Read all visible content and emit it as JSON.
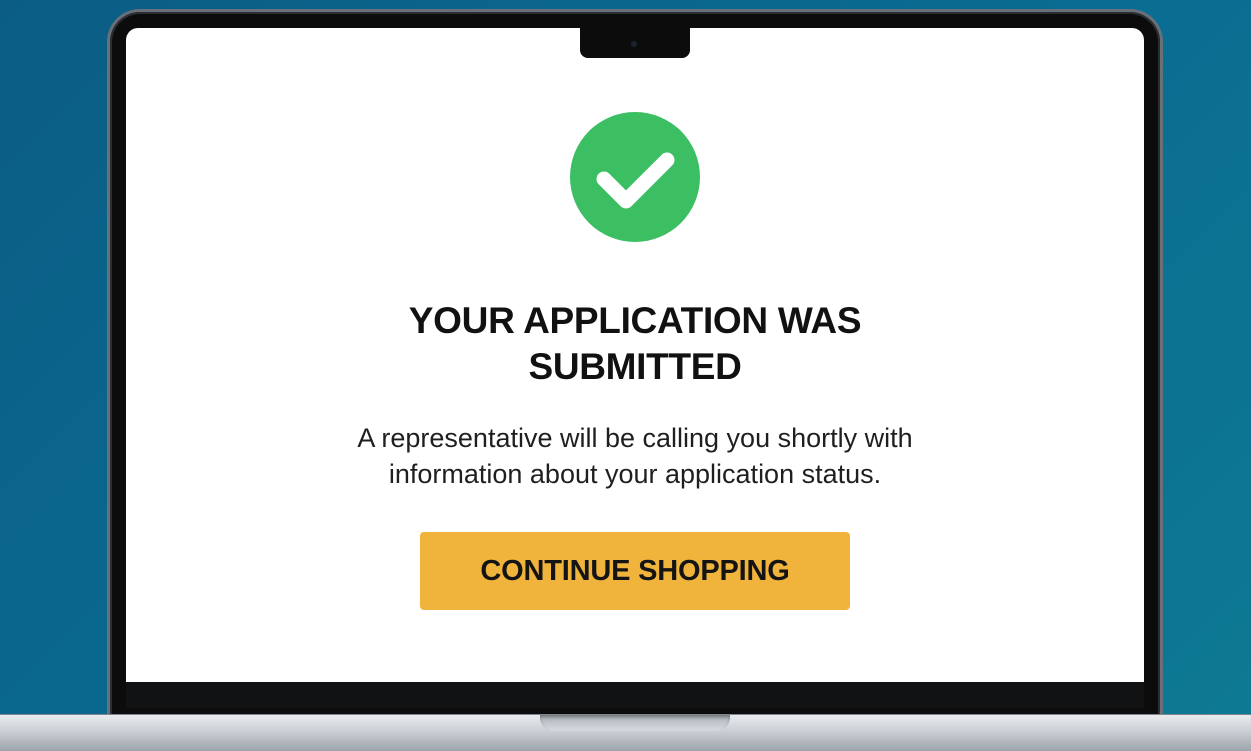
{
  "confirmation": {
    "icon": "check-circle-icon",
    "title_line1": "YOUR APPLICATION WAS",
    "title_line2": "SUBMITTED",
    "message_line1": "A representative will be calling you shortly with",
    "message_line2": "information about your application status.",
    "button_label": "CONTINUE SHOPPING"
  },
  "colors": {
    "success": "#3cbf63",
    "accent": "#f0b33c",
    "background": "#0b5d85"
  }
}
